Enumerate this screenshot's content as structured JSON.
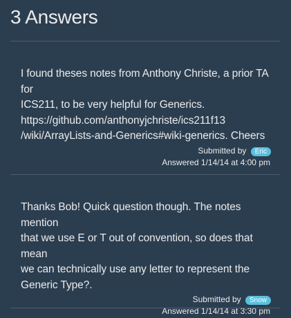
{
  "header": {
    "title": "3 Answers"
  },
  "answers": [
    {
      "text_lines": [
        "I found theses notes from Anthony Christe, a prior TA for",
        "ICS211, to be very helpful for Generics.",
        "https://github.com/anthonyjchriste/ics211f13",
        "/wiki/ArrayLists-and-Generics#wiki-generics. Cheers"
      ],
      "submitted_by_label": "Submitted by",
      "author": "Eric",
      "answered": "Answered 1/14/14 at 4:00 pm"
    },
    {
      "text_lines": [
        "Thanks Bob! Quick question though. The notes mention",
        "that we use E or T out of convention, so does that mean",
        "we can technically use any letter to represent the",
        "Generic Type?."
      ],
      "submitted_by_label": "Submitted by",
      "author": "Snow",
      "answered": "Answered 1/14/14 at 3:30 pm"
    }
  ],
  "colors": {
    "background": "#2b3e50",
    "text": "#ebebeb",
    "divider": "#4e5d6c",
    "badge": "#5bc0de"
  }
}
